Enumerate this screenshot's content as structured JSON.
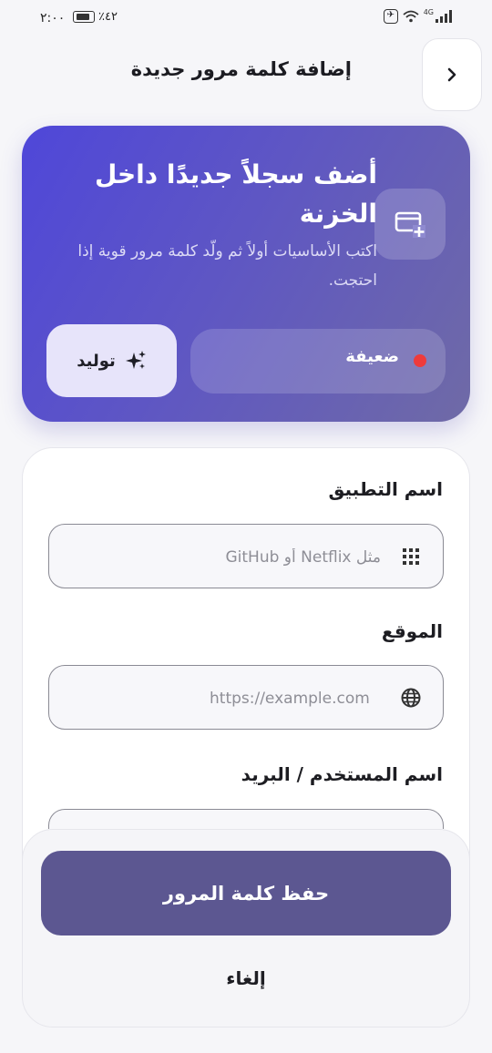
{
  "status_bar": {
    "time": "٢:٠٠",
    "battery_percent": "٪٤٢",
    "network": "4G"
  },
  "header": {
    "title": "إضافة كلمة مرور جديدة",
    "back_icon": "chevron-right-icon"
  },
  "hero": {
    "title": "أضف سجلاً جديدًا داخل الخزنة",
    "subtitle": "اكتب الأساسيات أولاً ثم ولّد كلمة مرور قوية إذا احتجت.",
    "icon": "add-card-icon",
    "strength_label": "ضعيفة",
    "strength_color": "#ee3b3b",
    "generate_label": "توليد",
    "generate_icon": "sparkles-icon"
  },
  "form": {
    "app_name": {
      "label": "اسم التطبيق",
      "placeholder": "مثل Netflix أو GitHub",
      "value": "",
      "icon": "apps-grid-icon"
    },
    "website": {
      "label": "الموقع",
      "placeholder": "https://example.com",
      "value": "",
      "icon": "globe-icon"
    },
    "username": {
      "label": "اسم المستخدم / البريد"
    }
  },
  "actions": {
    "save_label": "حفظ كلمة المرور",
    "cancel_label": "إلغاء"
  },
  "colors": {
    "accent": "#5c5791",
    "hero_gradient_start": "#4f47d9",
    "hero_gradient_end": "#6f6aa6",
    "background": "#f6f6f9"
  }
}
